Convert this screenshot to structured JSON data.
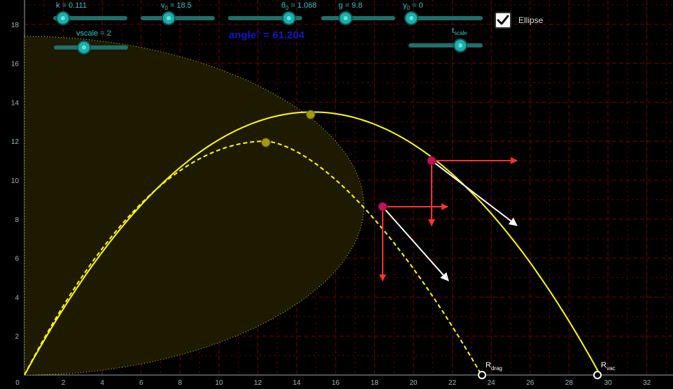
{
  "graph": {
    "x_ticks": [
      "0",
      "2",
      "4",
      "6",
      "8",
      "10",
      "12",
      "14",
      "16",
      "18",
      "20",
      "22",
      "24",
      "26",
      "28",
      "30",
      "32"
    ],
    "y_ticks": [
      "2",
      "4",
      "6",
      "8",
      "10",
      "12",
      "14",
      "16",
      "18"
    ]
  },
  "sliders": {
    "k": {
      "label": "k = 0.111",
      "value": 0.111
    },
    "v0": {
      "label_main": "v",
      "label_sub": "0",
      "label_rest": " = 18.5",
      "value": 18.5
    },
    "theta0": {
      "label_main": "θ",
      "label_sub": "0",
      "label_rest": " = 1.068",
      "value": 1.068
    },
    "g": {
      "label": "g = 9.8",
      "value": 9.8
    },
    "y0": {
      "label_main": "y",
      "label_sub": "0",
      "label_rest": " = 0",
      "value": 0
    },
    "vscale": {
      "label": "vscale = 2",
      "value": 2
    },
    "tscale": {
      "label_main": "t",
      "label_sub": "scale",
      "label_rest": ""
    }
  },
  "angle_text": "angle° = 61.204",
  "ellipse_checkbox": {
    "label": "Ellipse",
    "checked": true
  },
  "range_labels": {
    "drag": {
      "main": "R",
      "sub": "drag"
    },
    "vac": {
      "main": "R",
      "sub": "vac"
    }
  },
  "colors": {
    "background": "#000000",
    "grid": "#7a0000",
    "vacuum_path": "#ffff00",
    "drag_path": "#ffff00",
    "ellipse_fill": "#1e1a00",
    "apex_point": "#a19a10",
    "projectile": "#c0145a",
    "force_vector": "#ff3030",
    "velocity_vector": "#ffffff",
    "slider": "#1ab0ad",
    "angle_text": "#1414c8"
  }
}
